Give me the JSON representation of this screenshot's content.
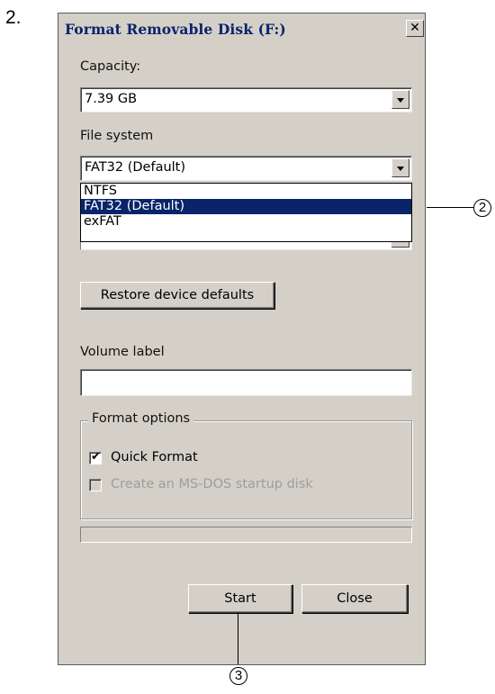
{
  "step_number": "2.",
  "window": {
    "title": "Format Removable Disk (F:)",
    "close_glyph": "✕"
  },
  "capacity": {
    "label": "Capacity:",
    "value": "7.39 GB"
  },
  "file_system": {
    "label": "File system",
    "value": "FAT32 (Default)",
    "options": [
      "NTFS",
      "FAT32 (Default)",
      "exFAT"
    ],
    "selected_option": "FAT32 (Default)"
  },
  "restore_defaults_label": "Restore device defaults",
  "volume_label": {
    "label": "Volume label",
    "value": ""
  },
  "format_options": {
    "legend": "Format options",
    "quick_format_label": "Quick Format",
    "quick_format_checked": true,
    "msdos_label": "Create an MS-DOS startup disk",
    "msdos_checked": false,
    "msdos_enabled": false
  },
  "progress_value": 0,
  "buttons": {
    "start_label": "Start",
    "close_label": "Close"
  },
  "callouts": {
    "dropdown_callout": "2",
    "start_callout": "3"
  },
  "icons": {
    "combo_arrow": "chevron-down-icon",
    "check": "checkmark-icon",
    "close": "close-icon"
  },
  "colors": {
    "dialog_bg": "#d4d0c8",
    "title_text": "#0a246a",
    "selection_bg": "#0a246a",
    "disabled_text": "#9d9d9d"
  }
}
